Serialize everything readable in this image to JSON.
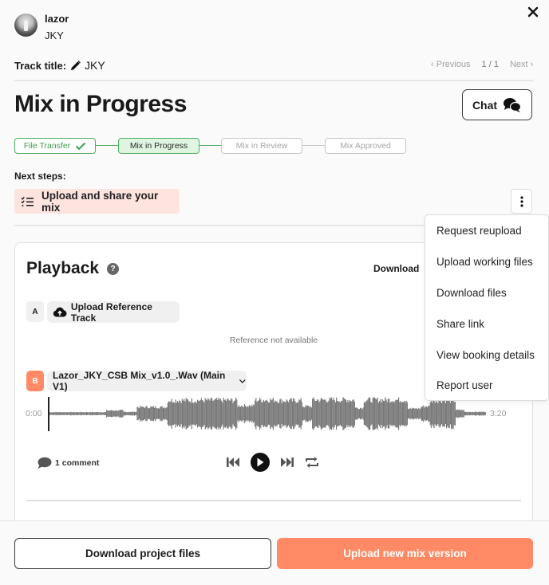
{
  "user": {
    "name": "lazor",
    "subtitle": "JKY"
  },
  "track": {
    "label": "Track title:",
    "value": "JKY"
  },
  "pager": {
    "previous": "Previous",
    "count": "1 / 1",
    "next": "Next"
  },
  "page_title": "Mix in Progress",
  "chat_button": "Chat",
  "stepper": [
    {
      "label": "File Transfer",
      "state": "done"
    },
    {
      "label": "Mix in Progress",
      "state": "current"
    },
    {
      "label": "Mix in Review",
      "state": "todo"
    },
    {
      "label": "Mix Approved",
      "state": "todo"
    }
  ],
  "next_steps": {
    "label": "Next steps:",
    "item": "Upload and share your mix"
  },
  "playback": {
    "title": "Playback",
    "help": "?",
    "download": "Download",
    "reference": {
      "badge": "A",
      "upload_label": "Upload Reference Track",
      "status": "Reference not available"
    },
    "mix": {
      "badge": "B",
      "version": "Lazor_JKY_CSB Mix_v1.0_.Wav (Main V1)",
      "time_start": "0:00",
      "time_end": "3:20",
      "progress": 0
    },
    "comments": "1 comment"
  },
  "menu": {
    "items": [
      "Request reupload",
      "Upload working files",
      "Download files",
      "Share link",
      "View booking details",
      "Report user"
    ]
  },
  "footer": {
    "download_project": "Download project files",
    "upload_mix": "Upload new mix version"
  },
  "colors": {
    "accent": "#ff8a65",
    "success": "#4caf60",
    "next_step_bg": "#fde4df",
    "waveform": "#7a7a7a"
  }
}
